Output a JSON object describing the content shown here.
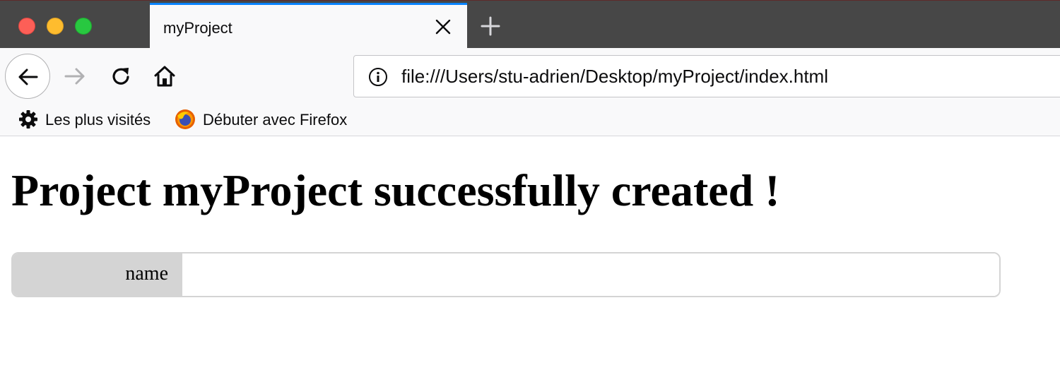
{
  "browser": {
    "window_controls": [
      "close",
      "minimize",
      "zoom"
    ],
    "tab": {
      "title": "myProject",
      "accent_color": "#0a84ff"
    },
    "toolbar": {
      "back_icon": "back-arrow-icon",
      "forward_icon": "forward-arrow-icon",
      "reload_icon": "reload-icon",
      "home_icon": "home-icon"
    },
    "urlbar": {
      "url": "file:///Users/stu-adrien/Desktop/myProject/index.html",
      "icon": "info-icon"
    },
    "bookmarks": [
      {
        "label": "Les plus visités",
        "icon": "gear-icon"
      },
      {
        "label": "Débuter avec Firefox",
        "icon": "firefox-logo-icon"
      }
    ]
  },
  "page": {
    "title": "Project myProject successfully created !",
    "form": {
      "label": "name",
      "value": ""
    }
  }
}
